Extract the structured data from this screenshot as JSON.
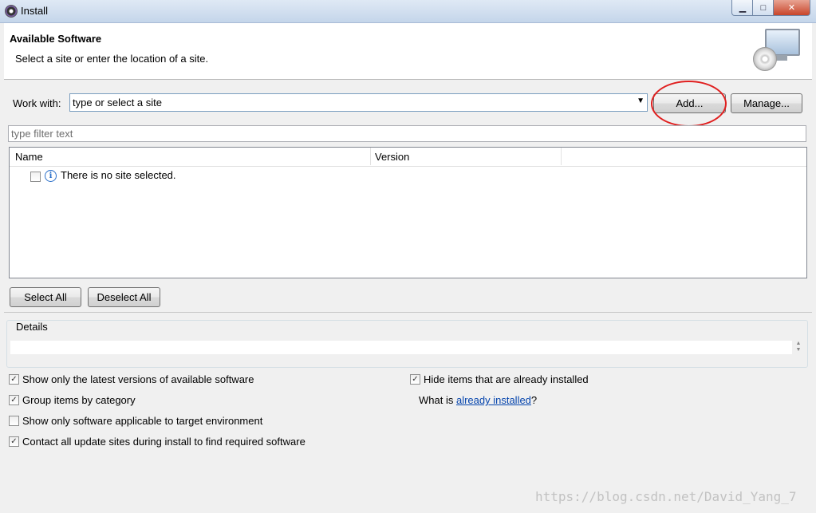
{
  "window": {
    "title": "Install",
    "buttons": {
      "minimize": "▁",
      "maximize": "□",
      "close": "✕"
    }
  },
  "header": {
    "title": "Available Software",
    "description": "Select a site or enter the location of a site."
  },
  "work_with": {
    "label": "Work with:",
    "value": "type or select a site",
    "add_label": "Add...",
    "manage_label": "Manage..."
  },
  "filter": {
    "placeholder": "type filter text"
  },
  "table": {
    "columns": [
      "Name",
      "Version"
    ],
    "rows": [
      {
        "text": "There is no site selected.",
        "checked": false
      }
    ]
  },
  "buttons": {
    "select_all": "Select All",
    "deselect_all": "Deselect All"
  },
  "details": {
    "label": "Details",
    "text": ""
  },
  "options": {
    "latest": {
      "label": "Show only the latest versions of available software",
      "checked": true
    },
    "group": {
      "label": "Group items by category",
      "checked": true
    },
    "target": {
      "label": "Show only software applicable to target environment",
      "checked": false
    },
    "contact": {
      "label": "Contact all update sites during install to find required software",
      "checked": true
    },
    "hide": {
      "label": "Hide items that are already installed",
      "checked": true
    }
  },
  "what_is": {
    "prefix": "What is ",
    "link": "already installed",
    "suffix": "?"
  },
  "watermark": "https://blog.csdn.net/David_Yang_7",
  "colors": {
    "highlight": "#e01f1f",
    "link": "#0645ad"
  }
}
